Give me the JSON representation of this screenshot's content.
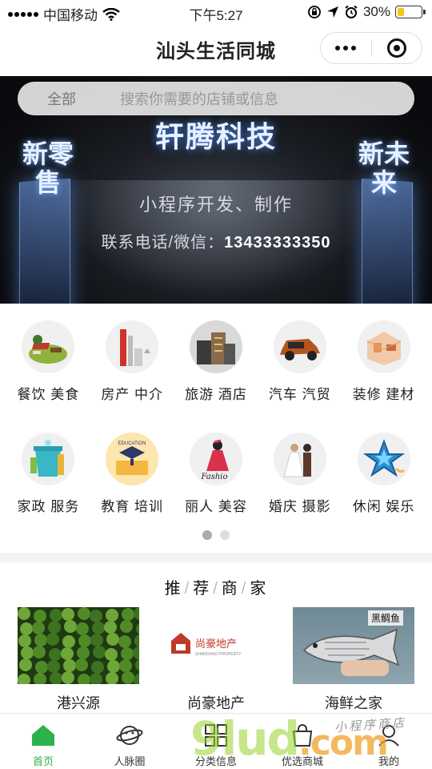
{
  "status_bar": {
    "carrier": "中国移动",
    "time": "下午5:27",
    "battery_percent": "30%",
    "battery_level": 0.3
  },
  "nav": {
    "title": "汕头生活同城"
  },
  "search": {
    "category": "全部",
    "placeholder": "搜索你需要的店铺或信息"
  },
  "banner": {
    "title": "轩腾科技",
    "left_text": "新零售",
    "right_text": "新未来",
    "subtitle": "小程序开发、制作",
    "contact_label": "联系电话/微信：",
    "contact_number": "13433333350"
  },
  "categories": [
    {
      "label": "餐饮 美食",
      "icon": "dining-icon"
    },
    {
      "label": "房产 中介",
      "icon": "real-estate-icon"
    },
    {
      "label": "旅游 酒店",
      "icon": "hotel-icon"
    },
    {
      "label": "汽车 汽贸",
      "icon": "car-icon"
    },
    {
      "label": "装修 建材",
      "icon": "decoration-icon"
    },
    {
      "label": "家政 服务",
      "icon": "housekeeping-icon"
    },
    {
      "label": "教育 培训",
      "icon": "education-icon"
    },
    {
      "label": "丽人 美容",
      "icon": "beauty-icon"
    },
    {
      "label": "婚庆 摄影",
      "icon": "wedding-icon"
    },
    {
      "label": "休闲 娱乐",
      "icon": "leisure-icon"
    }
  ],
  "category_icon_texts": {
    "education": "EDUCATION",
    "fashion": "Fashio"
  },
  "recommend": {
    "title": [
      "推",
      "荐",
      "商",
      "家"
    ],
    "merchants": [
      {
        "name": "港兴源"
      },
      {
        "name": "尚豪地产",
        "logo_text": "尚豪地产",
        "logo_sub": "SHANGHAO PROPERTY"
      },
      {
        "name": "海鲜之家",
        "tag": "黑鲷鱼"
      }
    ]
  },
  "tabbar": [
    {
      "label": "首页",
      "icon": "home-icon",
      "active": true
    },
    {
      "label": "人脉圈",
      "icon": "planet-icon",
      "active": false
    },
    {
      "label": "分类信息",
      "icon": "category-icon",
      "active": false
    },
    {
      "label": "优选商城",
      "icon": "shop-icon",
      "active": false
    },
    {
      "label": "我的",
      "icon": "profile-icon",
      "active": false
    }
  ],
  "watermark": {
    "brand": "9lud",
    "domain": ".com",
    "handwriting": "小程序商店"
  },
  "colors": {
    "accent_green": "#2bb24c",
    "battery_yellow": "#f5c518"
  }
}
